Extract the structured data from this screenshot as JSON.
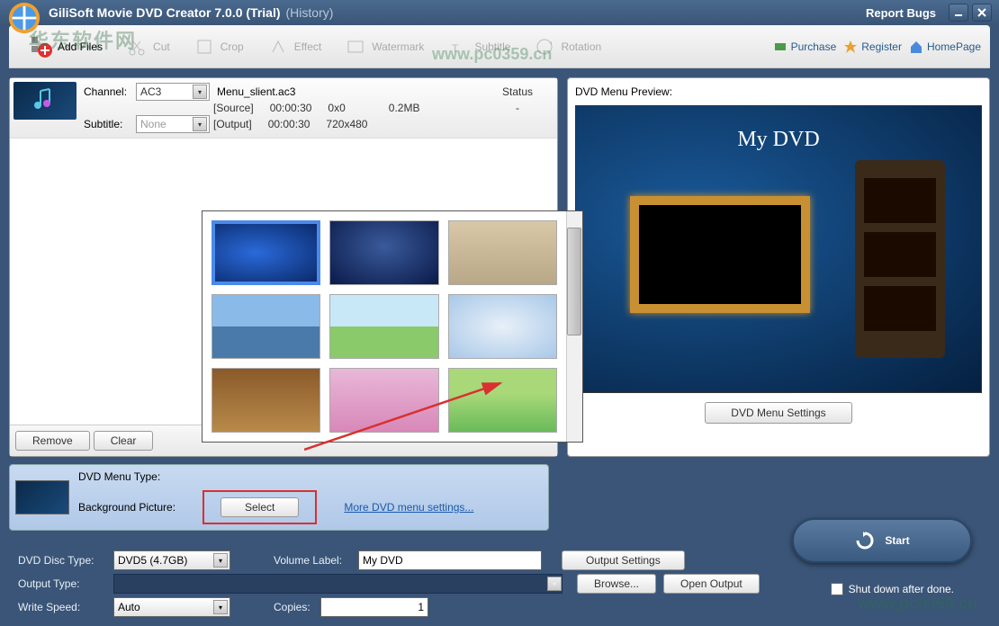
{
  "titlebar": {
    "app_title": "GiliSoft Movie DVD Creator 7.0.0 (Trial)",
    "history_label": "(History)",
    "report_bugs": "Report Bugs"
  },
  "toolbar": {
    "add_files": "Add Files",
    "cut": "Cut",
    "crop": "Crop",
    "effect": "Effect",
    "watermark": "Watermark",
    "subtitle": "Subtitle",
    "rotation": "Rotation",
    "purchase": "Purchase",
    "register": "Register",
    "homepage": "HomePage"
  },
  "file": {
    "channel_label": "Channel:",
    "channel_value": "AC3",
    "subtitle_label": "Subtitle:",
    "subtitle_value": "None",
    "filename": "Menu_slient.ac3",
    "source_label": "[Source]",
    "source_duration": "00:00:30",
    "source_res": "0x0",
    "source_size": "0.2MB",
    "output_label": "[Output]",
    "output_duration": "00:00:30",
    "output_res": "720x480",
    "status_header": "Status",
    "status_value": "-"
  },
  "actions": {
    "remove": "Remove",
    "clear": "Clear"
  },
  "menu": {
    "type_label": "DVD Menu Type:",
    "bg_label": "Background  Picture:",
    "select": "Select",
    "more_settings": "More DVD menu settings..."
  },
  "preview": {
    "title": "DVD Menu Preview:",
    "menu_title": "My DVD",
    "settings_btn": "DVD Menu Settings"
  },
  "bottom": {
    "disc_type_label": "DVD Disc Type:",
    "disc_type_value": "DVD5 (4.7GB)",
    "volume_label": "Volume Label:",
    "volume_value": "My DVD",
    "output_settings": "Output Settings",
    "output_type_label": "Output Type:",
    "browse": "Browse...",
    "open_output": "Open Output",
    "write_speed_label": "Write Speed:",
    "write_speed_value": "Auto",
    "copies_label": "Copies:",
    "copies_value": "1",
    "shutdown": "Shut down after done.",
    "start": "Start"
  },
  "watermarks": {
    "site_cn": "华东软件网",
    "site_url": "www.pc0359.cn"
  }
}
